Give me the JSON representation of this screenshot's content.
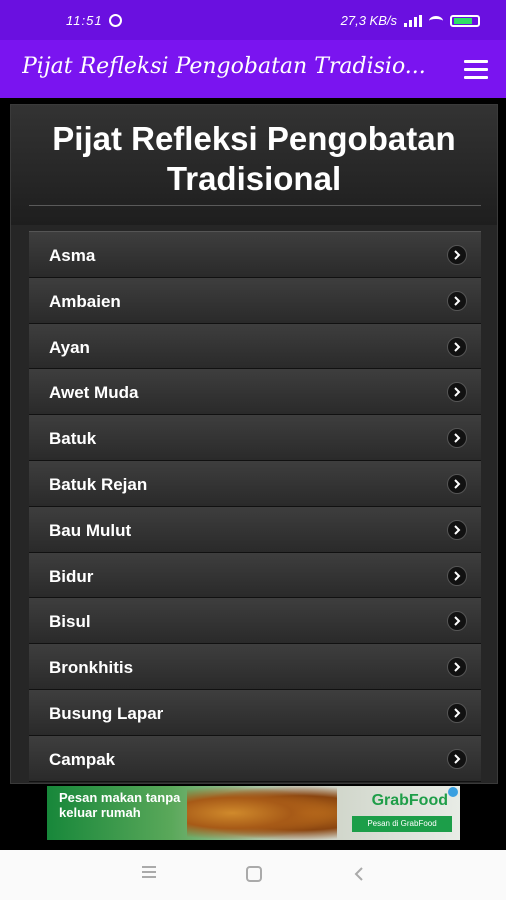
{
  "status_bar": {
    "time": "11:51",
    "right_text": "27,3 KB/s"
  },
  "app_bar": {
    "title": "Pijat Refleksi Pengobatan Tradisio...",
    "menu_icon": "hamburger-menu-icon"
  },
  "header": {
    "title": "Pijat Refleksi Pengobatan Tradisional"
  },
  "list": {
    "items": [
      {
        "label": "Asma"
      },
      {
        "label": "Ambaien"
      },
      {
        "label": "Ayan"
      },
      {
        "label": "Awet Muda"
      },
      {
        "label": "Batuk"
      },
      {
        "label": "Batuk Rejan"
      },
      {
        "label": "Bau Mulut"
      },
      {
        "label": "Bidur"
      },
      {
        "label": "Bisul"
      },
      {
        "label": "Bronkhitis"
      },
      {
        "label": "Busung Lapar"
      },
      {
        "label": "Campak"
      }
    ],
    "item_icon": "chevron-right-icon"
  },
  "ad": {
    "text": "Pesan makan tanpa keluar rumah",
    "brand": "GrabFood",
    "cta": "Pesan di GrabFood"
  },
  "colors": {
    "status_bar": "#6a10e0",
    "app_bar": "#7a14f0",
    "panel": "#262626"
  }
}
